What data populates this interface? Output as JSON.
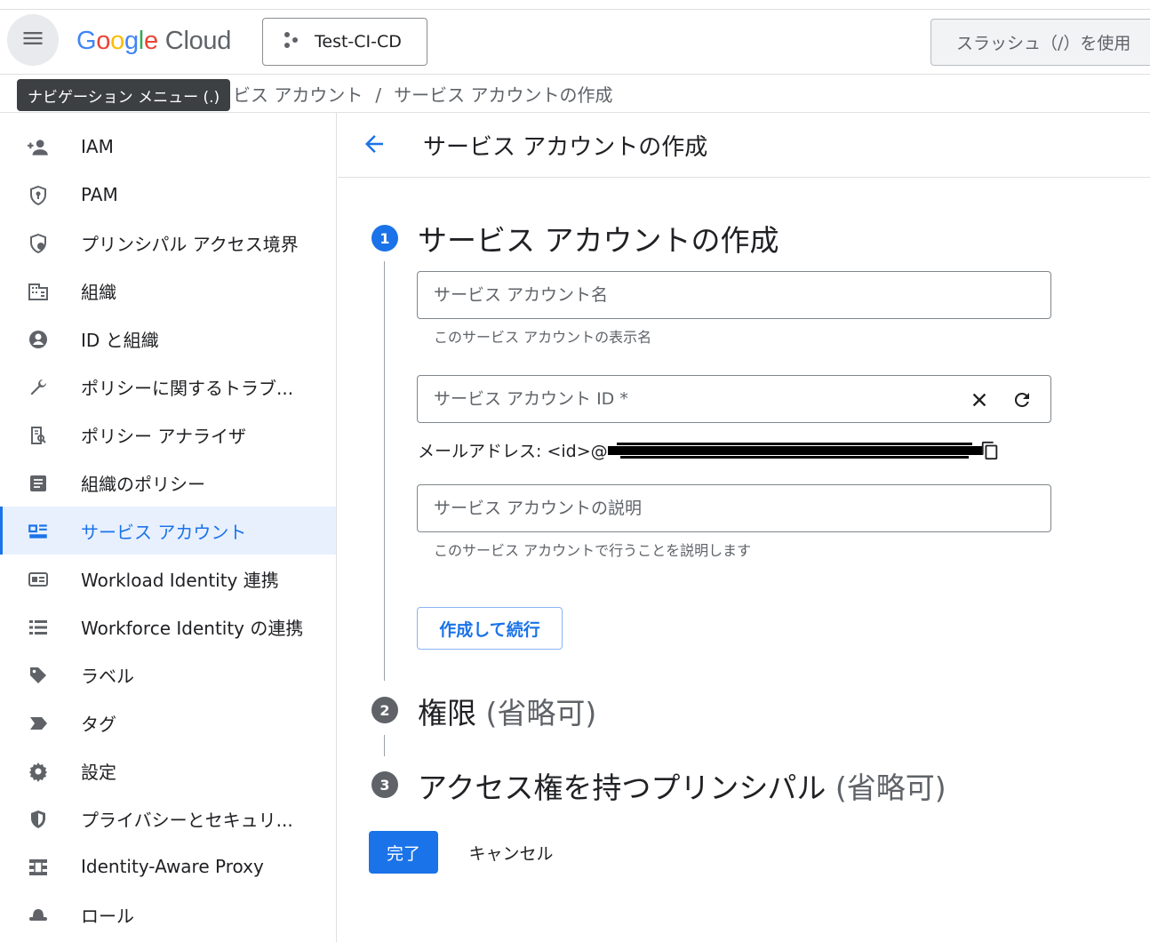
{
  "header": {
    "logo_google": [
      "G",
      "o",
      "o",
      "g",
      "l",
      "e"
    ],
    "logo_cloud": "Cloud",
    "project_name": "Test-CI-CD",
    "search_placeholder": "スラッシュ（/）を使用"
  },
  "breadcrumb": {
    "parent": "ビス アカウント",
    "separator": "/",
    "current": "サービス アカウントの作成"
  },
  "tooltip": "ナビゲーション メニュー (.)",
  "sidebar": {
    "items": [
      {
        "label": "IAM",
        "icon": "person-add-icon"
      },
      {
        "label": "PAM",
        "icon": "shield-lock-icon"
      },
      {
        "label": "プリンシパル アクセス境界",
        "icon": "shield-person-icon"
      },
      {
        "label": "組織",
        "icon": "building-icon"
      },
      {
        "label": "ID と組織",
        "icon": "account-circle-icon"
      },
      {
        "label": "ポリシーに関するトラブ...",
        "icon": "wrench-icon"
      },
      {
        "label": "ポリシー アナライザ",
        "icon": "policy-search-icon"
      },
      {
        "label": "組織のポリシー",
        "icon": "document-icon"
      },
      {
        "label": "サービス アカウント",
        "icon": "service-account-icon",
        "active": true
      },
      {
        "label": "Workload Identity 連携",
        "icon": "id-card-icon"
      },
      {
        "label": "Workforce Identity の連携",
        "icon": "list-icon"
      },
      {
        "label": "ラベル",
        "icon": "label-icon"
      },
      {
        "label": "タグ",
        "icon": "tag-icon"
      },
      {
        "label": "設定",
        "icon": "gear-icon"
      },
      {
        "label": "プライバシーとセキュリ...",
        "icon": "shield-icon"
      },
      {
        "label": "Identity-Aware Proxy",
        "icon": "proxy-icon"
      },
      {
        "label": "ロール",
        "icon": "hat-icon"
      }
    ]
  },
  "main": {
    "title": "サービス アカウントの作成",
    "steps": [
      {
        "number": "1",
        "title": "サービス アカウントの作成",
        "optional": ""
      },
      {
        "number": "2",
        "title": "権限",
        "optional": "(省略可)"
      },
      {
        "number": "3",
        "title": "アクセス権を持つプリンシパル",
        "optional": "(省略可)"
      }
    ],
    "form": {
      "name_placeholder": "サービス アカウント名",
      "name_helper": "このサービス アカウントの表示名",
      "id_placeholder": "サービス アカウント ID *",
      "email_label": "メールアドレス: <id>@",
      "description_placeholder": "サービス アカウントの説明",
      "description_helper": "このサービス アカウントで行うことを説明します",
      "create_continue": "作成して続行"
    },
    "done_button": "完了",
    "cancel_button": "キャンセル"
  },
  "colors": {
    "accent": "#1a73e8",
    "active_bg": "#e8f0fe",
    "google_blue": "#4285f4",
    "google_red": "#ea4335",
    "google_yellow": "#fbbc04",
    "google_green": "#34a853"
  }
}
